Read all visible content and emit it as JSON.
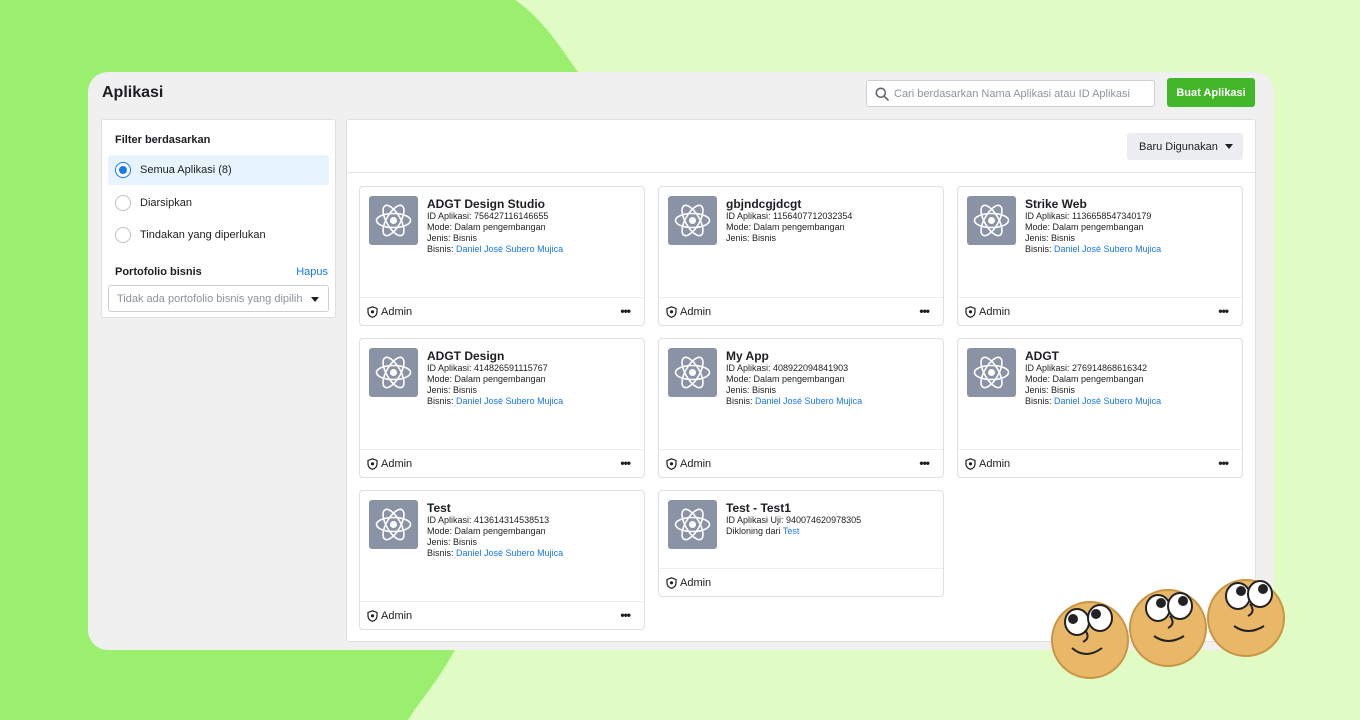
{
  "header": {
    "title": "Aplikasi",
    "search_placeholder": "Cari berdasarkan Nama Aplikasi atau ID Aplikasi",
    "create_button": "Buat Aplikasi"
  },
  "sidebar": {
    "filter_title": "Filter berdasarkan",
    "filters": [
      {
        "label": "Semua Aplikasi (8)",
        "selected": true
      },
      {
        "label": "Diarsipkan",
        "selected": false
      },
      {
        "label": "Tindakan yang diperlukan",
        "selected": false
      }
    ],
    "portfolio_title": "Portofolio bisnis",
    "portfolio_clear": "Hapus",
    "portfolio_placeholder": "Tidak ada portofolio bisnis yang dipilih"
  },
  "main": {
    "sort_label": "Baru Digunakan",
    "role_label": "Admin",
    "more_label": "•••",
    "apps": [
      {
        "name": "ADGT Design Studio",
        "id_line": "ID Aplikasi: 756427116146655",
        "mode": "Mode: Dalam pengembangan",
        "type": "Jenis: Bisnis",
        "business_prefix": "Bisnis:",
        "business": "Daniel José Subero Mujica"
      },
      {
        "name": "gbjndcgjdcgt",
        "id_line": "ID Aplikasi: 1156407712032354",
        "mode": "Mode: Dalam pengembangan",
        "type": "Jenis: Bisnis"
      },
      {
        "name": "Strike Web",
        "id_line": "ID Aplikasi: 1136658547340179",
        "mode": "Mode: Dalam pengembangan",
        "type": "Jenis: Bisnis",
        "business_prefix": "Bisnis:",
        "business": "Daniel José Subero Mujica"
      },
      {
        "name": "ADGT Design",
        "id_line": "ID Aplikasi: 414826591115767",
        "mode": "Mode: Dalam pengembangan",
        "type": "Jenis: Bisnis",
        "business_prefix": "Bisnis:",
        "business": "Daniel José Subero Mujica"
      },
      {
        "name": "My App",
        "id_line": "ID Aplikasi: 408922094841903",
        "mode": "Mode: Dalam pengembangan",
        "type": "Jenis: Bisnis",
        "business_prefix": "Bisnis:",
        "business": "Daniel José Subero Mujica"
      },
      {
        "name": "ADGT",
        "id_line": "ID Aplikasi: 276914868616342",
        "mode": "Mode: Dalam pengembangan",
        "type": "Jenis: Bisnis",
        "business_prefix": "Bisnis:",
        "business": "Daniel José Subero Mujica"
      },
      {
        "name": "Test",
        "id_line": "ID Aplikasi: 413614314538513",
        "mode": "Mode: Dalam pengembangan",
        "type": "Jenis: Bisnis",
        "business_prefix": "Bisnis:",
        "business": "Daniel José Subero Mujica"
      },
      {
        "name": "Test - Test1",
        "id_line": "ID Aplikasi Uji: 940074620978305",
        "cloned_prefix": "Dikloning dari",
        "cloned_from": "Test"
      }
    ]
  },
  "colors": {
    "accent_green": "#42b72a",
    "link_blue": "#1877f2",
    "background_light": "#e0fbc4",
    "background_dark": "#9bef6e"
  }
}
